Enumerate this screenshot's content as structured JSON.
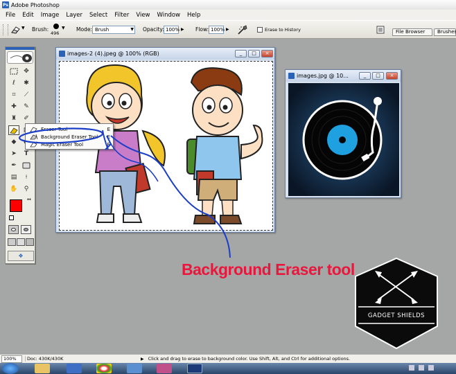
{
  "app": {
    "title": "Adobe Photoshop"
  },
  "menu": [
    "File",
    "Edit",
    "Image",
    "Layer",
    "Select",
    "Filter",
    "View",
    "Window",
    "Help"
  ],
  "options": {
    "brush_label": "Brush:",
    "brush_size": "496",
    "mode_label": "Mode:",
    "mode_value": "Brush",
    "opacity_label": "Opacity:",
    "opacity_value": "100%",
    "flow_label": "Flow:",
    "flow_value": "100%",
    "erase_history_label": "Erase to History",
    "tabs": [
      "File Browser",
      "Brushes"
    ]
  },
  "toolbox": {
    "foreground_color": "#ff0000",
    "background_color": "#ffffff"
  },
  "flyout": {
    "items": [
      {
        "label": "Eraser Tool",
        "key": "E"
      },
      {
        "label": "Background Eraser Tool",
        "key": "E"
      },
      {
        "label": "Magic Eraser Tool",
        "key": "E"
      }
    ]
  },
  "doc1": {
    "title": "images-2 (4).jpeg @ 100% (RGB)"
  },
  "doc2": {
    "title": "images.jpg @ 10..."
  },
  "annotation": {
    "text": "Background Eraser tool",
    "color": "#e8173d"
  },
  "logo": {
    "text": "GADGET SHIELDS"
  },
  "status": {
    "zoom": "100%",
    "doc": "Doc: 430K/430K",
    "hint": "Click and drag to erase to background color.  Use Shift, Alt, and Ctrl for additional options."
  }
}
